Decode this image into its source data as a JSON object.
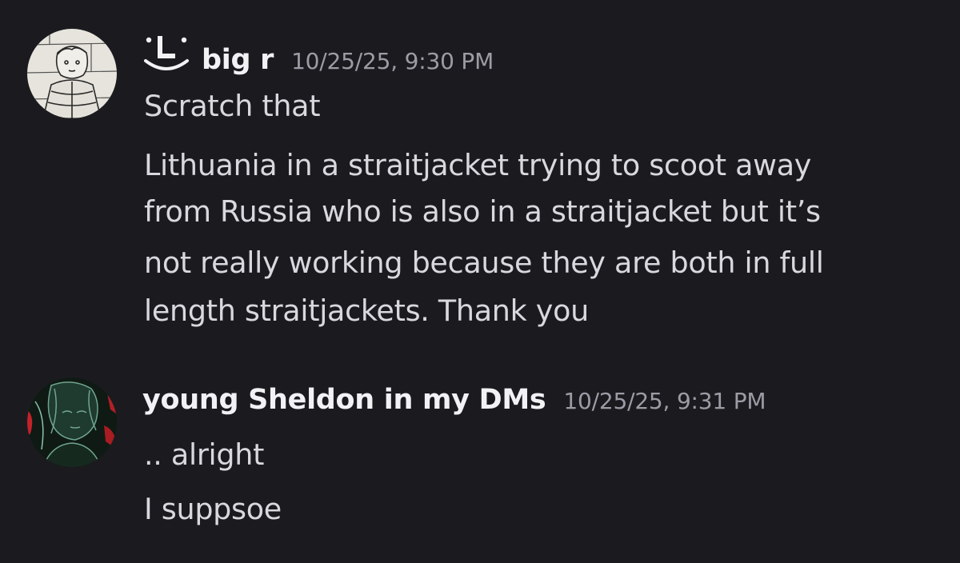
{
  "messages": [
    {
      "author": "big r",
      "timestamp": "10/25/25, 9:30 PM",
      "lines": [
        "Scratch that",
        "Lithuania in a straitjacket trying to scoot away",
        "from Russia who is also in a straitjacket but it’s",
        "not really working because they are both in full",
        "length straitjackets. Thank you"
      ],
      "avatar_icon": "sketch-avatar",
      "tag_icon": "smile-l-icon"
    },
    {
      "author": "young Sheldon in my DMs",
      "timestamp": "10/25/25, 9:31 PM",
      "lines": [
        ".. alright",
        "I suppsoe"
      ],
      "avatar_icon": "dark-green-avatar"
    }
  ],
  "colors": {
    "background": "#1b1b1f",
    "username": "#f2f2f5",
    "timestamp": "#9c9ca6",
    "message_text": "#d8d8de"
  }
}
